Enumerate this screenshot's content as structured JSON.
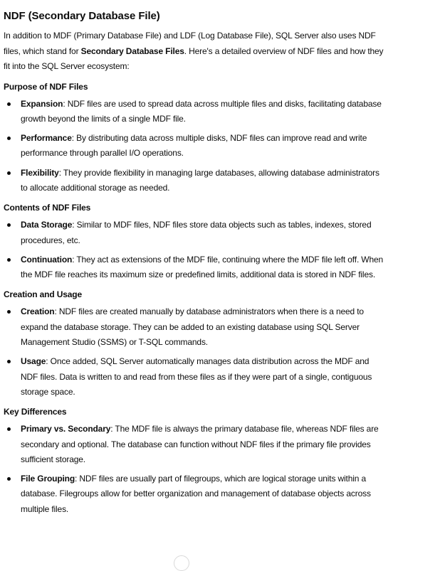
{
  "title": "NDF (Secondary Database File)",
  "intro": {
    "before": "In addition to MDF (Primary Database File) and LDF (Log Database File), SQL Server also uses NDF files, which stand for ",
    "bold": "Secondary Database Files",
    "after": ". Here's a detailed overview of NDF files and how they fit into the SQL Server ecosystem:"
  },
  "sections": [
    {
      "heading": "Purpose of NDF Files",
      "items": [
        {
          "term": "Expansion",
          "text": ": NDF files are used to spread data across multiple files and disks, facilitating database growth beyond the limits of a single MDF file."
        },
        {
          "term": "Performance",
          "text": ": By distributing data across multiple disks, NDF files can improve read and write performance through parallel I/O operations."
        },
        {
          "term": "Flexibility",
          "text": ": They provide flexibility in managing large databases, allowing database administrators to allocate additional storage as needed."
        }
      ]
    },
    {
      "heading": "Contents of NDF Files",
      "items": [
        {
          "term": "Data Storage",
          "text": ": Similar to MDF files, NDF files store data objects such as tables, indexes, stored procedures, etc."
        },
        {
          "term": "Continuation",
          "text": ": They act as extensions of the MDF file, continuing where the MDF file left off. When the MDF file reaches its maximum size or predefined limits, additional data is stored in NDF files."
        }
      ]
    },
    {
      "heading": "Creation and Usage",
      "items": [
        {
          "term": "Creation",
          "text": ": NDF files are created manually by database administrators when there is a need to expand the database storage. They can be added to an existing database using SQL Server Management Studio (SSMS) or T-SQL commands."
        },
        {
          "term": "Usage",
          "text": ": Once added, SQL Server automatically manages data distribution across the MDF and NDF files. Data is written to and read from these files as if they were part of a single, contiguous storage space."
        }
      ]
    },
    {
      "heading": "Key Differences",
      "items": [
        {
          "term": "Primary vs. Secondary",
          "text": ": The MDF file is always the primary database file, whereas NDF files are secondary and optional. The database can function without NDF files if the primary file provides sufficient storage."
        },
        {
          "term": "File Grouping",
          "text": ": NDF files are usually part of filegroups, which are logical storage units within a database. Filegroups allow for better organization and management of database objects across multiple files."
        }
      ]
    }
  ]
}
